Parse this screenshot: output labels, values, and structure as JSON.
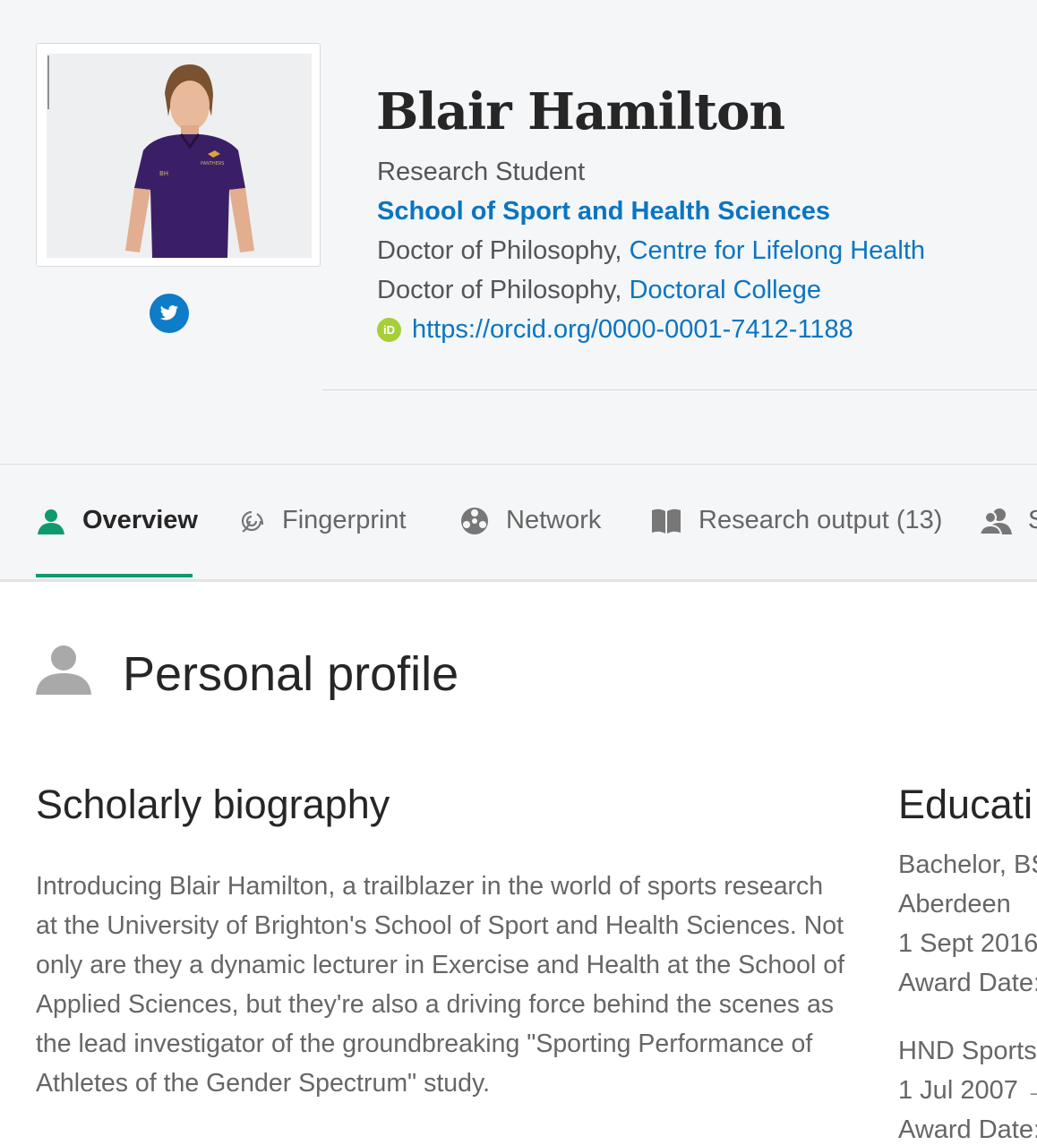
{
  "profile": {
    "name": "Blair Hamilton",
    "role": "Research Student",
    "school": "School of Sport and Health Sciences",
    "affiliations": [
      {
        "degree": "Doctor of Philosophy,",
        "unit": "Centre for Lifelong Health"
      },
      {
        "degree": "Doctor of Philosophy,",
        "unit": "Doctoral College"
      }
    ],
    "orcid_badge": "iD",
    "orcid_url": "https://orcid.org/0000-0001-7412-1188",
    "photo_shirt_initials": "BH",
    "photo_shirt_text": "PANTHERS"
  },
  "tabs": [
    {
      "label": "Overview",
      "icon": "person-icon",
      "active": true
    },
    {
      "label": "Fingerprint",
      "icon": "fingerprint-icon",
      "active": false
    },
    {
      "label": "Network",
      "icon": "network-icon",
      "active": false
    },
    {
      "label": "Research output (13)",
      "icon": "book-icon",
      "active": false
    },
    {
      "label": "S",
      "icon": "people-icon",
      "active": false
    }
  ],
  "section_title": "Personal profile",
  "biography": {
    "heading": "Scholarly biography",
    "text": "Introducing Blair Hamilton, a trailblazer in the world of sports research at the University of Brighton's School of Sport and Health Sciences. Not only are they a dynamic lecturer in Exercise and Health at the School of Applied Sciences, but they're also a driving force behind the scenes as the lead investigator of the groundbreaking \"Sporting Performance of Athletes of the Gender Spectrum\" study."
  },
  "education": {
    "heading": "Educati",
    "lines": [
      "Bachelor, BS",
      "Aberdeen",
      "1 Sept 2016",
      "Award Date:",
      "HND Sports",
      "1 Jul 2007 →",
      "Award Date:"
    ]
  },
  "colors": {
    "accent_blue": "#0a75c2",
    "active_green": "#0e9a6e",
    "twitter_blue": "#0e7cc7",
    "orcid_green": "#a6ce39"
  }
}
